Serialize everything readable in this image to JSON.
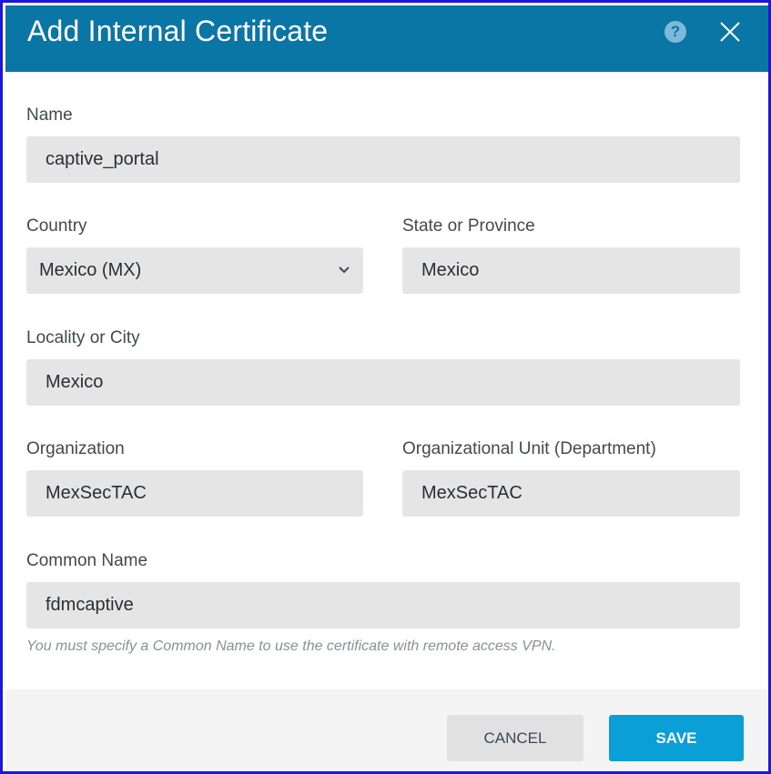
{
  "dialog": {
    "title": "Add Internal Certificate",
    "help_icon": "question-circle-icon",
    "help_glyph": "?",
    "close_icon": "close-icon"
  },
  "form": {
    "name": {
      "label": "Name",
      "value": "captive_portal"
    },
    "country": {
      "label": "Country",
      "value": "Mexico (MX)"
    },
    "state": {
      "label": "State or Province",
      "value": "Mexico"
    },
    "locality": {
      "label": "Locality or City",
      "value": "Mexico"
    },
    "organization": {
      "label": "Organization",
      "value": "MexSecTAC"
    },
    "org_unit": {
      "label": "Organizational Unit (Department)",
      "value": "MexSecTAC"
    },
    "common_name": {
      "label": "Common Name",
      "value": "fdmcaptive",
      "hint": "You must specify a Common Name to use the certificate with remote access VPN."
    }
  },
  "footer": {
    "cancel_label": "CANCEL",
    "save_label": "SAVE"
  },
  "colors": {
    "header_bg": "#0a76a6",
    "save_bg": "#0b9fd8",
    "field_bg": "#e5e5e5",
    "frame_border": "#1a16e6"
  }
}
